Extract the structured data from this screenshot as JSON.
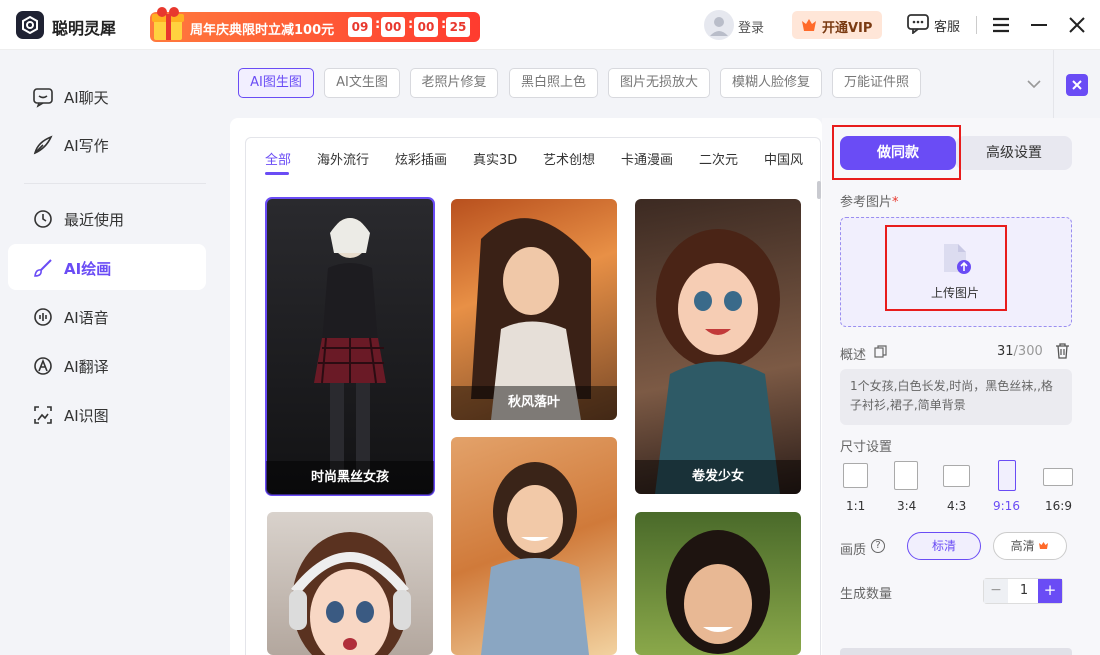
{
  "app": {
    "name": "聪明灵犀"
  },
  "promo": {
    "text": "周年庆典限时立减100元",
    "countdown": [
      "09",
      "00",
      "00",
      "25"
    ]
  },
  "header": {
    "login": "登录",
    "vip": "开通VIP",
    "service": "客服"
  },
  "sidebar": {
    "items": [
      {
        "label": "AI聊天",
        "icon": "chat-icon"
      },
      {
        "label": "AI写作",
        "icon": "pen-icon"
      },
      {
        "label": "最近使用",
        "icon": "history-icon"
      },
      {
        "label": "AI绘画",
        "icon": "brush-icon",
        "active": true
      },
      {
        "label": "AI语音",
        "icon": "voice-icon"
      },
      {
        "label": "AI翻译",
        "icon": "translate-icon"
      },
      {
        "label": "AI识图",
        "icon": "scan-icon"
      }
    ]
  },
  "feature_tabs": [
    "AI图生图",
    "AI文生图",
    "老照片修复",
    "黑白照上色",
    "图片无损放大",
    "模糊人脸修复",
    "万能证件照"
  ],
  "category_tabs": [
    "全部",
    "海外流行",
    "炫彩插画",
    "真实3D",
    "艺术创想",
    "卡通漫画",
    "二次元",
    "中国风"
  ],
  "gallery": [
    {
      "caption": "时尚黑丝女孩",
      "selected": true
    },
    {
      "caption": "秋风落叶"
    },
    {
      "caption": "卷发少女"
    },
    {
      "caption": ""
    },
    {
      "caption": ""
    },
    {
      "caption": ""
    }
  ],
  "panel": {
    "mode_primary": "做同款",
    "mode_secondary": "高级设置",
    "ref_label": "参考图片",
    "required_mark": "*",
    "upload_text": "上传图片",
    "desc_label": "概述",
    "count_current": "31",
    "count_max": "/300",
    "description": "1个女孩,白色长发,时尚，黑色丝袜,,格子衬衫,裙子,简单背景",
    "size_label": "尺寸设置",
    "sizes": [
      "1:1",
      "3:4",
      "4:3",
      "9:16",
      "16:9"
    ],
    "selected_size": "9:16",
    "quality_label": "画质",
    "quality_help": "?",
    "quality_options": [
      "标清",
      "高清"
    ],
    "quantity_label": "生成数量",
    "quantity": "1",
    "minus": "−",
    "plus": "+"
  },
  "colors": {
    "accent": "#6a4cf5",
    "promo": "#ff3b2f",
    "highlight": "#e81c1c"
  }
}
